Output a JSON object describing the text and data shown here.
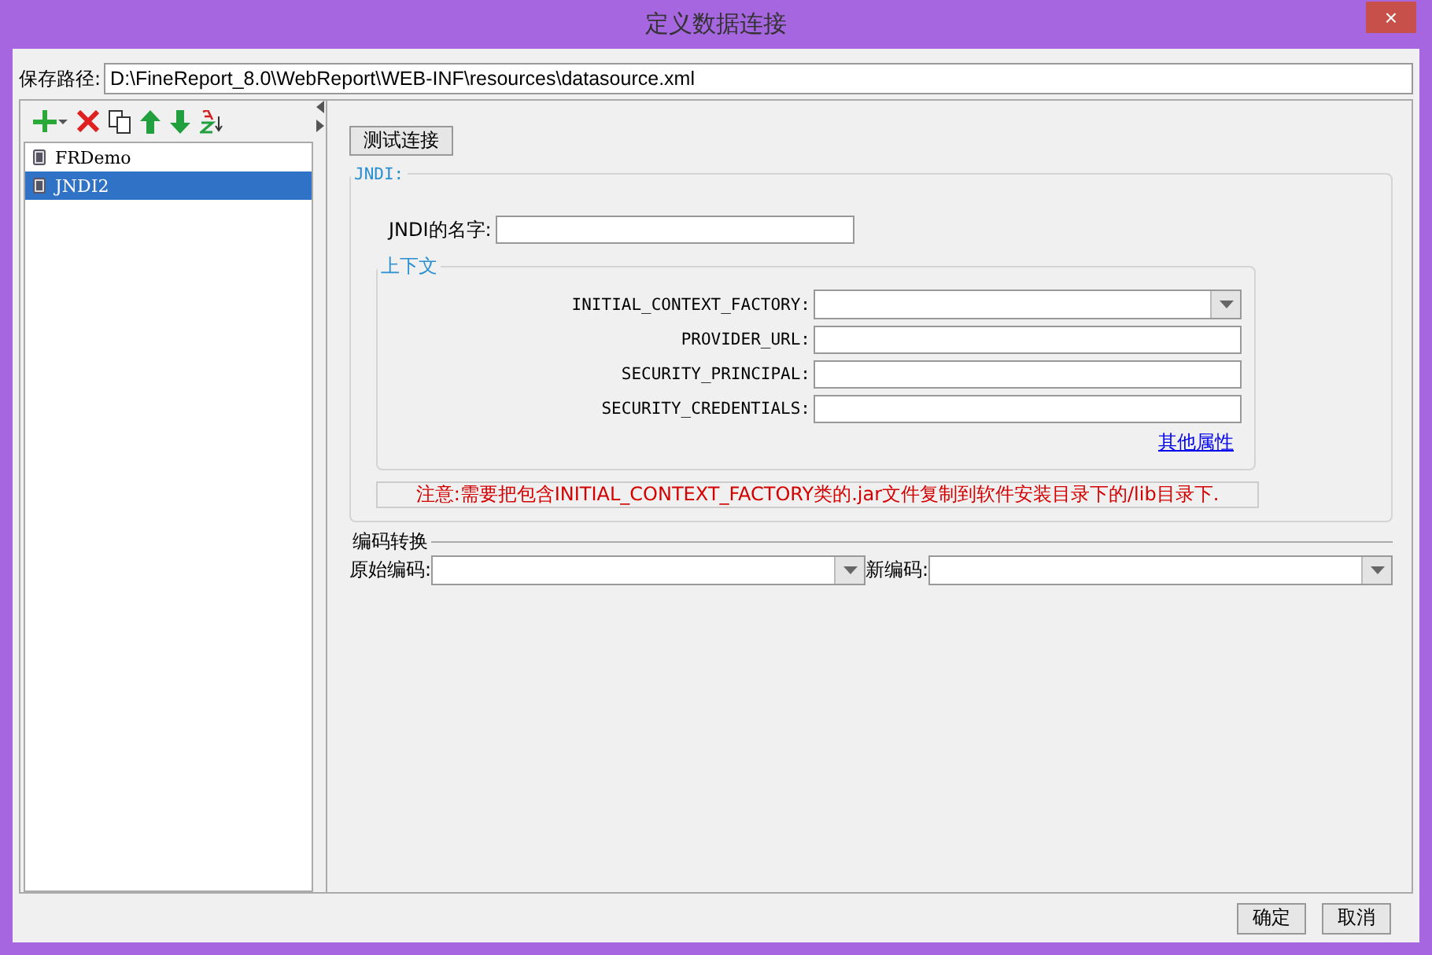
{
  "window": {
    "title": "定义数据连接",
    "close": "×"
  },
  "save_path": {
    "label": "保存路径:",
    "value": "D:\\FineReport_8.0\\WebReport\\WEB-INF\\resources\\datasource.xml"
  },
  "connections": [
    {
      "name": "FRDemo",
      "selected": false
    },
    {
      "name": "JNDI2",
      "selected": true
    }
  ],
  "test_button": "测试连接",
  "jndi": {
    "legend": "JNDI:",
    "name_label": "JNDI的名字:",
    "context": {
      "legend": "上下文",
      "fields": [
        {
          "label": "INITIAL_CONTEXT_FACTORY:",
          "kind": "dropdown"
        },
        {
          "label": "PROVIDER_URL:",
          "kind": "text"
        },
        {
          "label": "SECURITY_PRINCIPAL:",
          "kind": "text"
        },
        {
          "label": "SECURITY_CREDENTIALS:",
          "kind": "text"
        }
      ],
      "link": "其他属性"
    },
    "note": "注意:需要把包含INITIAL_CONTEXT_FACTORY类的.jar文件复制到软件安装目录下的/lib目录下."
  },
  "encoding": {
    "legend": "编码转换",
    "original_label": "原始编码:",
    "new_label": "新编码:"
  },
  "buttons": [
    "确定",
    "取消"
  ]
}
